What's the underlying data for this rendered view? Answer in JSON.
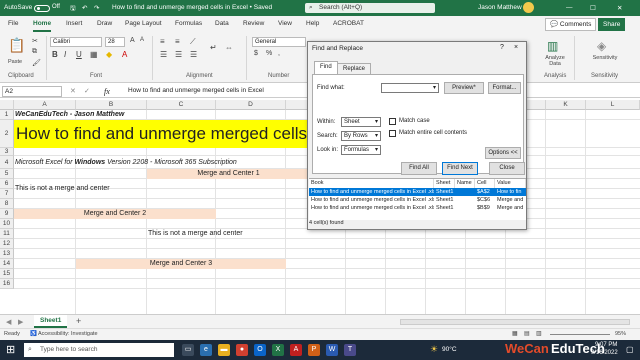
{
  "titlebar": {
    "autosave": "AutoSave",
    "autosave_state": "Off",
    "doc_title": "How to find and unmerge merged cells in Excel • Saved",
    "search_placeholder": "Search (Alt+Q)",
    "user": "Jason Matthew"
  },
  "menu": {
    "items": [
      "File",
      "Home",
      "Insert",
      "Draw",
      "Page Layout",
      "Formulas",
      "Data",
      "Review",
      "View",
      "Help",
      "ACROBAT"
    ],
    "active": "Home",
    "comments": "Comments",
    "share": "Share"
  },
  "ribbon": {
    "paste": "Paste",
    "font_name": "Calibri",
    "font_size": "28",
    "number_format": "General",
    "analyze_data": "Analyze Data",
    "sensitivity": "Sensitivity",
    "groups": [
      "Clipboard",
      "Font",
      "Alignment",
      "Number",
      "Analysis",
      "Sensitivity"
    ]
  },
  "formula_bar": {
    "name_box": "A2",
    "fx": "fx",
    "content": "How to find and unmerge merged cells in Excel"
  },
  "grid": {
    "columns": [
      "A",
      "B",
      "C",
      "D",
      "E",
      "F",
      "G",
      "H",
      "I",
      "J",
      "K",
      "L"
    ],
    "rows": [
      "1",
      "2",
      "3",
      "4",
      "5",
      "6",
      "7",
      "8",
      "9",
      "10",
      "11",
      "12",
      "13",
      "14",
      "15",
      "16"
    ],
    "cells": {
      "wecan": "WeCanEduTech - Jason Matthew",
      "title": "How to find and unmerge merged cells in Excel",
      "subtitle_pre": "Microsoft Excel for ",
      "subtitle_bold": "Windows",
      "subtitle_post": " Version 2208 - Microsoft 365 Subscription",
      "mc1": "Merge and Center 1",
      "not_merge_1": "This is not a merge and center",
      "mc2": "Merge and Center 2",
      "not_merge_2": "This is not a merge and center",
      "mc3": "Merge and Center 3"
    }
  },
  "dialog": {
    "title": "Find and Replace",
    "help": "?",
    "close": "×",
    "tabs": [
      "Find",
      "Replace"
    ],
    "find_what_label": "Find what:",
    "find_what_value": "",
    "preview_button": "Preview*",
    "format_button": "Format...",
    "within_label": "Within:",
    "within_value": "Sheet",
    "search_label": "Search:",
    "search_value": "By Rows",
    "lookin_label": "Look in:",
    "lookin_value": "Formulas",
    "match_case": "Match case",
    "match_entire": "Match entire cell contents",
    "options_button": "Options <<",
    "find_all": "Find All",
    "find_next": "Find Next",
    "close_button": "Close",
    "result_headers": [
      "Book",
      "Sheet",
      "Name",
      "Cell",
      "Value"
    ],
    "results": [
      {
        "book": "How to find and unmerge merged cells in Excel .xlsx",
        "sheet": "Sheet1",
        "name": "",
        "cell": "$A$2",
        "value": "How to fin"
      },
      {
        "book": "How to find and unmerge merged cells in Excel .xlsx",
        "sheet": "Sheet1",
        "name": "",
        "cell": "$C$6",
        "value": "Merge and"
      },
      {
        "book": "How to find and unmerge merged cells in Excel .xlsx",
        "sheet": "Sheet1",
        "name": "",
        "cell": "$B$9",
        "value": "Merge and"
      }
    ],
    "footer": "4 cell(s) found"
  },
  "sheet": {
    "tab": "Sheet1",
    "add": "+"
  },
  "status": {
    "ready": "Ready",
    "accessibility": "Accessibility: Investigate",
    "zoom": "95%"
  },
  "taskbar": {
    "search_placeholder": "Type here to search",
    "temperature": "90°C",
    "time": "9:07 PM",
    "date": "9/16/2022",
    "brand_1": "WeCan",
    "brand_2": "EduTech"
  },
  "colors": {
    "excel_green": "#217346",
    "merge_fill": "#fbe0cd",
    "title_fill": "#ffff00",
    "selection_blue": "#0078d7"
  }
}
